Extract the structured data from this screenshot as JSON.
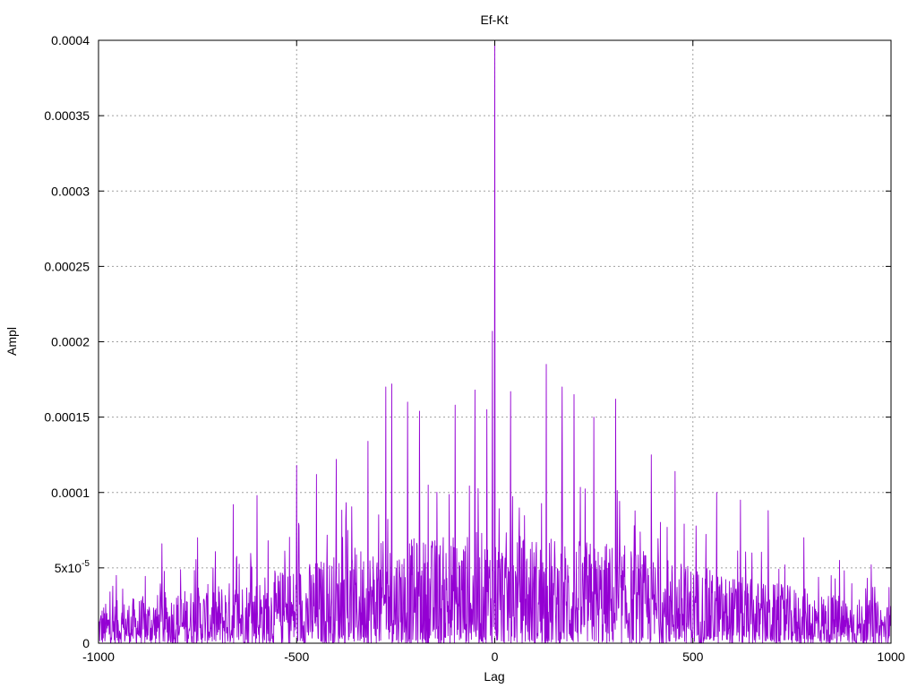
{
  "chart_data": {
    "type": "line",
    "title": "Ef-Kt",
    "xlabel": "Lag",
    "ylabel": "Ampl",
    "xlim": [
      -1000,
      1000
    ],
    "ylim": [
      0,
      0.0004
    ],
    "grid": true,
    "legend": "none",
    "x_ticks": [
      {
        "value": -1000,
        "label": "-1000"
      },
      {
        "value": -500,
        "label": "-500"
      },
      {
        "value": 0,
        "label": "0"
      },
      {
        "value": 500,
        "label": "500"
      },
      {
        "value": 1000,
        "label": "1000"
      }
    ],
    "y_ticks": [
      {
        "value": 0,
        "label": "0"
      },
      {
        "value": 5e-05,
        "label": "5x10",
        "exponent": "-5"
      },
      {
        "value": 0.0001,
        "label": "0.0001"
      },
      {
        "value": 0.00015,
        "label": "0.00015"
      },
      {
        "value": 0.0002,
        "label": "0.0002"
      },
      {
        "value": 0.00025,
        "label": "0.00025"
      },
      {
        "value": 0.0003,
        "label": "0.0003"
      },
      {
        "value": 0.00035,
        "label": "0.00035"
      },
      {
        "value": 0.0004,
        "label": "0.0004"
      }
    ],
    "series": [
      {
        "color": "#9400d3",
        "x_range": [
          -1000,
          1000
        ],
        "peak": {
          "x": 0,
          "y": 0.0004
        },
        "envelope": [
          [
            -1000,
            3.5e-05
          ],
          [
            -600,
            6e-05
          ],
          [
            -300,
            9e-05
          ],
          [
            0,
            0.0001
          ],
          [
            300,
            9e-05
          ],
          [
            600,
            6e-05
          ],
          [
            1000,
            3.5e-05
          ]
        ],
        "notable_peaks": [
          {
            "x": -955,
            "y": 4.5e-05
          },
          {
            "x": -840,
            "y": 6.6e-05
          },
          {
            "x": -750,
            "y": 7e-05
          },
          {
            "x": -660,
            "y": 9.2e-05
          },
          {
            "x": -600,
            "y": 9.8e-05
          },
          {
            "x": -500,
            "y": 0.000118
          },
          {
            "x": -450,
            "y": 0.000112
          },
          {
            "x": -400,
            "y": 0.000122
          },
          {
            "x": -320,
            "y": 0.000134
          },
          {
            "x": -275,
            "y": 0.00017
          },
          {
            "x": -260,
            "y": 0.000172
          },
          {
            "x": -220,
            "y": 0.00016
          },
          {
            "x": -190,
            "y": 0.000154
          },
          {
            "x": -100,
            "y": 0.000158
          },
          {
            "x": -50,
            "y": 0.000168
          },
          {
            "x": -20,
            "y": 0.000155
          },
          {
            "x": -6,
            "y": 0.000207
          },
          {
            "x": 40,
            "y": 0.000167
          },
          {
            "x": 130,
            "y": 0.000185
          },
          {
            "x": 170,
            "y": 0.00017
          },
          {
            "x": 200,
            "y": 0.000165
          },
          {
            "x": 250,
            "y": 0.00015
          },
          {
            "x": 305,
            "y": 0.000162
          },
          {
            "x": 395,
            "y": 0.000125
          },
          {
            "x": 455,
            "y": 0.000114
          },
          {
            "x": 560,
            "y": 0.0001
          },
          {
            "x": 620,
            "y": 9.5e-05
          },
          {
            "x": 690,
            "y": 8.8e-05
          },
          {
            "x": 780,
            "y": 7e-05
          },
          {
            "x": 870,
            "y": 5.5e-05
          },
          {
            "x": 950,
            "y": 5.2e-05
          },
          {
            "x": 995,
            "y": 3.7e-05
          }
        ]
      }
    ]
  }
}
